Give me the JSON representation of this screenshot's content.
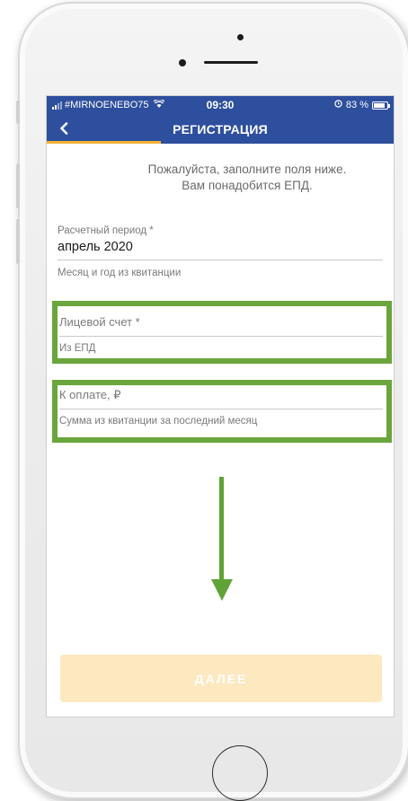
{
  "status_bar": {
    "carrier": "#MIRNOENEBO75",
    "time": "09:30",
    "battery_text": "83 %",
    "battery_level": 0.83,
    "wifi_icon": "wifi-icon",
    "alarm_icon": "alarm-icon"
  },
  "header": {
    "title": "РЕГИСТРАЦИЯ",
    "back_icon": "chevron-left-icon"
  },
  "intro": {
    "line1": "Пожалуйста, заполните поля ниже.",
    "line2": "Вам понадобится ЕПД."
  },
  "fields": {
    "period": {
      "label": "Расчетный период *",
      "value": "апрель 2020",
      "hint": "Месяц и год из квитанции"
    },
    "account": {
      "label": "Лицевой счет *",
      "placeholder": "Из ЕПД"
    },
    "amount": {
      "label": "К оплате, ₽",
      "placeholder": "Сумма из квитанции за последний месяц"
    }
  },
  "next_button": {
    "label": "ДАЛЕЕ"
  },
  "colors": {
    "brand": "#2e4f9d",
    "accent": "#f2b233",
    "highlight": "#6aa53d",
    "button_disabled": "#fde9c0"
  }
}
